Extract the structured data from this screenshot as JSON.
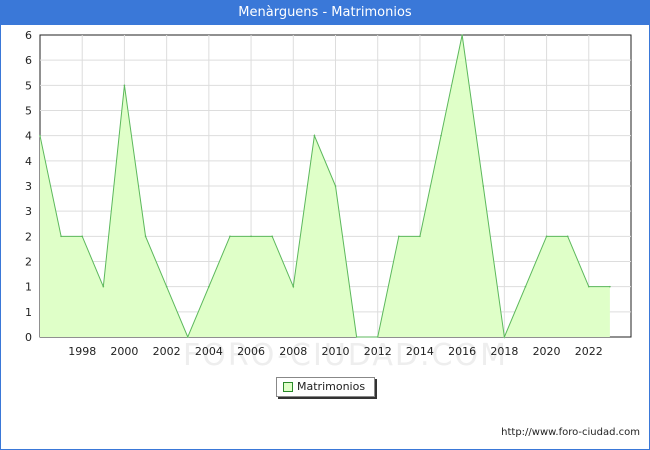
{
  "header": {
    "title": "Menàrguens - Matrimonios"
  },
  "chart_data": {
    "type": "area",
    "x": [
      1996,
      1997,
      1998,
      1999,
      2000,
      2001,
      2002,
      2003,
      2004,
      2005,
      2006,
      2007,
      2008,
      2009,
      2010,
      2011,
      2012,
      2013,
      2014,
      2015,
      2016,
      2017,
      2018,
      2019,
      2020,
      2021,
      2022,
      2023
    ],
    "series": [
      {
        "name": "Matrimonios",
        "values": [
          4,
          2,
          2,
          1,
          5,
          2,
          1,
          0,
          1,
          2,
          2,
          2,
          1,
          4,
          3,
          0,
          0,
          2,
          2,
          4,
          6,
          3,
          0,
          1,
          2,
          2,
          1,
          1
        ]
      }
    ],
    "xlim": [
      1996,
      2024
    ],
    "ylim": [
      0,
      6
    ],
    "x_ticks": [
      "1998",
      "2000",
      "2002",
      "2004",
      "2006",
      "2008",
      "2010",
      "2012",
      "2014",
      "2016",
      "2018",
      "2020",
      "2022"
    ],
    "y_ticks": [
      "0",
      "1",
      "1",
      "2",
      "2",
      "3",
      "3",
      "4",
      "4",
      "5",
      "5",
      "6",
      "6"
    ],
    "grid": true,
    "legend_position": "bottom-center",
    "watermark": "FORO-CIUDAD.COM",
    "colors": {
      "fill": "#dfffc8",
      "line": "#5cb85c",
      "header": "#3a78d8"
    }
  },
  "legend": {
    "label": "Matrimonios"
  },
  "footer": {
    "source": "http://www.foro-ciudad.com"
  }
}
